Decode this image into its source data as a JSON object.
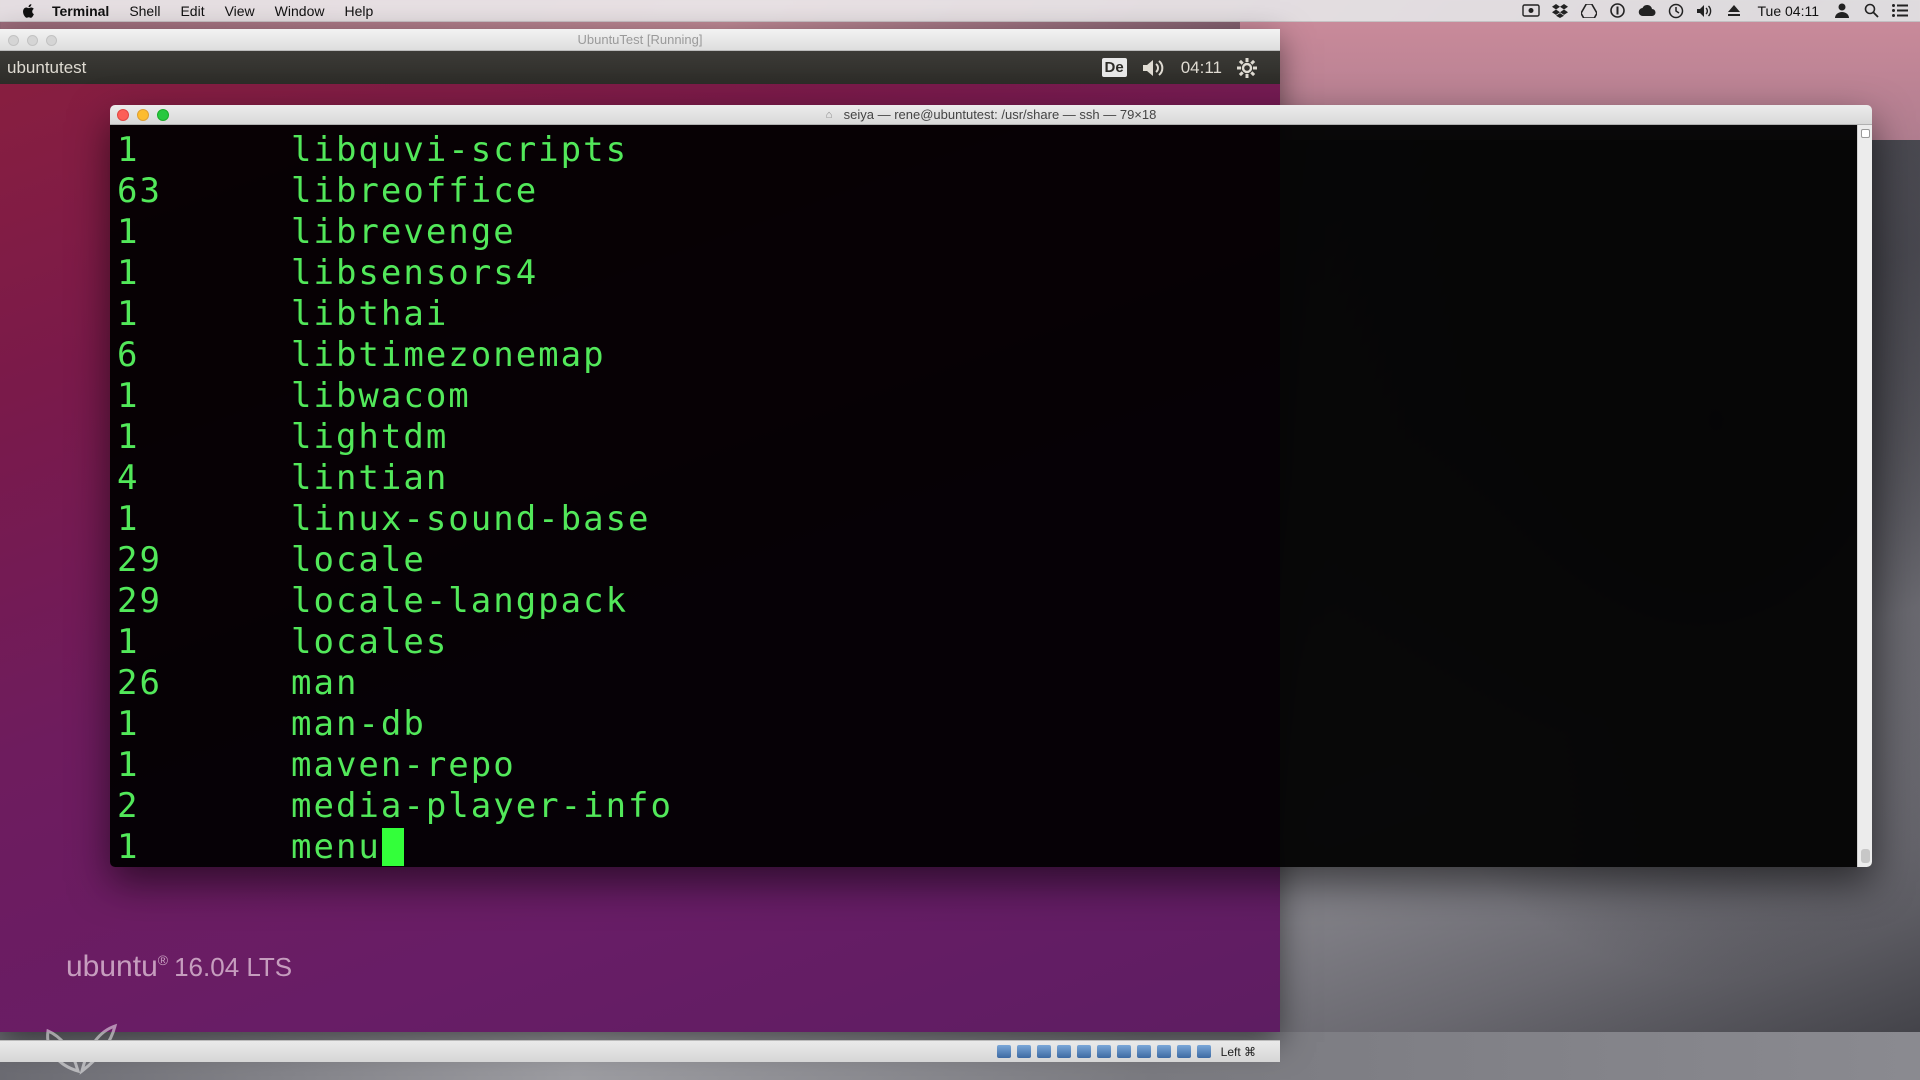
{
  "menubar": {
    "app_name": "Terminal",
    "menus": [
      "Shell",
      "Edit",
      "View",
      "Window",
      "Help"
    ],
    "clock": "Tue 04:11"
  },
  "vbox": {
    "window_title": "UbuntuTest [Running]",
    "host_key": "Left ⌘"
  },
  "ubuntu_panel": {
    "title": "ubuntutest",
    "keyboard_layout": "De",
    "time": "04:11"
  },
  "ubuntu_logo": {
    "name": "ubuntu",
    "version": "16.04 LTS"
  },
  "terminal": {
    "title": "seiya — rene@ubuntutest: /usr/share — ssh — 79×18",
    "lines": [
      {
        "count": "1",
        "name": "libquvi-scripts"
      },
      {
        "count": "63",
        "name": "libreoffice"
      },
      {
        "count": "1",
        "name": "librevenge"
      },
      {
        "count": "1",
        "name": "libsensors4"
      },
      {
        "count": "1",
        "name": "libthai"
      },
      {
        "count": "6",
        "name": "libtimezonemap"
      },
      {
        "count": "1",
        "name": "libwacom"
      },
      {
        "count": "1",
        "name": "lightdm"
      },
      {
        "count": "4",
        "name": "lintian"
      },
      {
        "count": "1",
        "name": "linux-sound-base"
      },
      {
        "count": "29",
        "name": "locale"
      },
      {
        "count": "29",
        "name": "locale-langpack"
      },
      {
        "count": "1",
        "name": "locales"
      },
      {
        "count": "26",
        "name": "man"
      },
      {
        "count": "1",
        "name": "man-db"
      },
      {
        "count": "1",
        "name": "maven-repo"
      },
      {
        "count": "2",
        "name": "media-player-info"
      },
      {
        "count": "1",
        "name": "menu"
      }
    ],
    "text_color": "#52e85a",
    "cursor_color": "#33ff3a"
  }
}
